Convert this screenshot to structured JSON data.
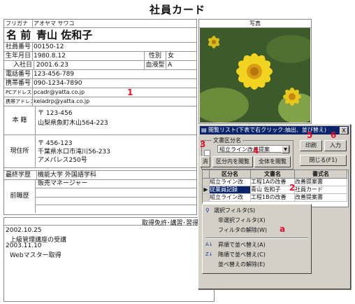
{
  "title": "社員カード",
  "card": {
    "furigana_label": "フリガナ",
    "furigana_value": "アオヤマ サワコ",
    "name_label": "名 前",
    "name_value": "青山 佐和子",
    "emp_no_label": "社員番号",
    "emp_no_value": "00150-12",
    "birth_label": "生年月日",
    "birth_value": "1980.8.12",
    "gender_label": "性別",
    "gender_value": "女",
    "join_label": "入社日",
    "join_value": "2001.6.23",
    "blood_label": "血液型",
    "blood_value": "A",
    "phone_label": "電話番号",
    "phone_value": "123-456-789",
    "mobile_label": "携帯番号",
    "mobile_value": "090-1234-7890",
    "pc_addr_label": "PCアドレス",
    "pc_addr_value": "pcadr@yatta.co.jp",
    "mobile_addr_label": "携帯アドレス",
    "mobile_addr_value": "keiadrp@yatta.co.jp",
    "honseki_label": "本 籍",
    "honseki_zip": "〒 123-456",
    "honseki_value": "山梨県魚町木山564-223",
    "address_label": "現住所",
    "address_zip": "〒 456-123",
    "address_line1": "千葉県水口市滝川56-233",
    "address_line2": "アメパレス250号",
    "education_label": "最終学歴",
    "education_value": "機能大学 外国語学科",
    "prev_job_label": "前職歴",
    "prev_job_value": "販売マネージャー",
    "marker_1": "1"
  },
  "photo": {
    "header": "写真"
  },
  "qualifications": {
    "header": "取得免許･講習･習得技術",
    "lines": [
      "2002.10.25",
      "上級管理講座の受講",
      "2003.11.10",
      "Webマスター取得"
    ]
  },
  "dialog": {
    "title": "閲覧リスト(下表で右クリック:抽出、並び替え)",
    "close": "X",
    "doc_type_label": "文書区分名",
    "doc_type_value": "組立ライン改善提案",
    "erase_button": "消",
    "view_by_type_button": "区分内を閲覧",
    "view_all_button": "全体を閲覧",
    "print_button": "印刷",
    "input_button": "入力",
    "close_button": "閉じる(F1)",
    "columns": [
      "区分名",
      "文書名",
      "書式名"
    ],
    "rows": [
      [
        "組立ライン改",
        "工程1Aの改善",
        "改善提案書"
      ],
      [
        "従業員記録",
        "青山 佐和子",
        "社員カード"
      ],
      [
        "組立ライン改",
        "工程1Bの改善",
        "改善提案書"
      ]
    ],
    "markers": {
      "m2": "2",
      "m3": "3",
      "m4": "4",
      "m5": "5",
      "m6": "6",
      "ma": "a"
    }
  },
  "context_menu": {
    "items": [
      "選択フィルタ(S)",
      "非選択フィルタ(X)",
      "フィルタの解除(W)",
      "昇順で並べ替え(A)",
      "降順で並べ替え(C)",
      "並べ替えの解除(E)"
    ]
  },
  "colors": {
    "marker": "#e8102a",
    "titlebar": "#0a246a",
    "dialog_bg": "#d4d0c8",
    "selection": "#0a246a"
  }
}
